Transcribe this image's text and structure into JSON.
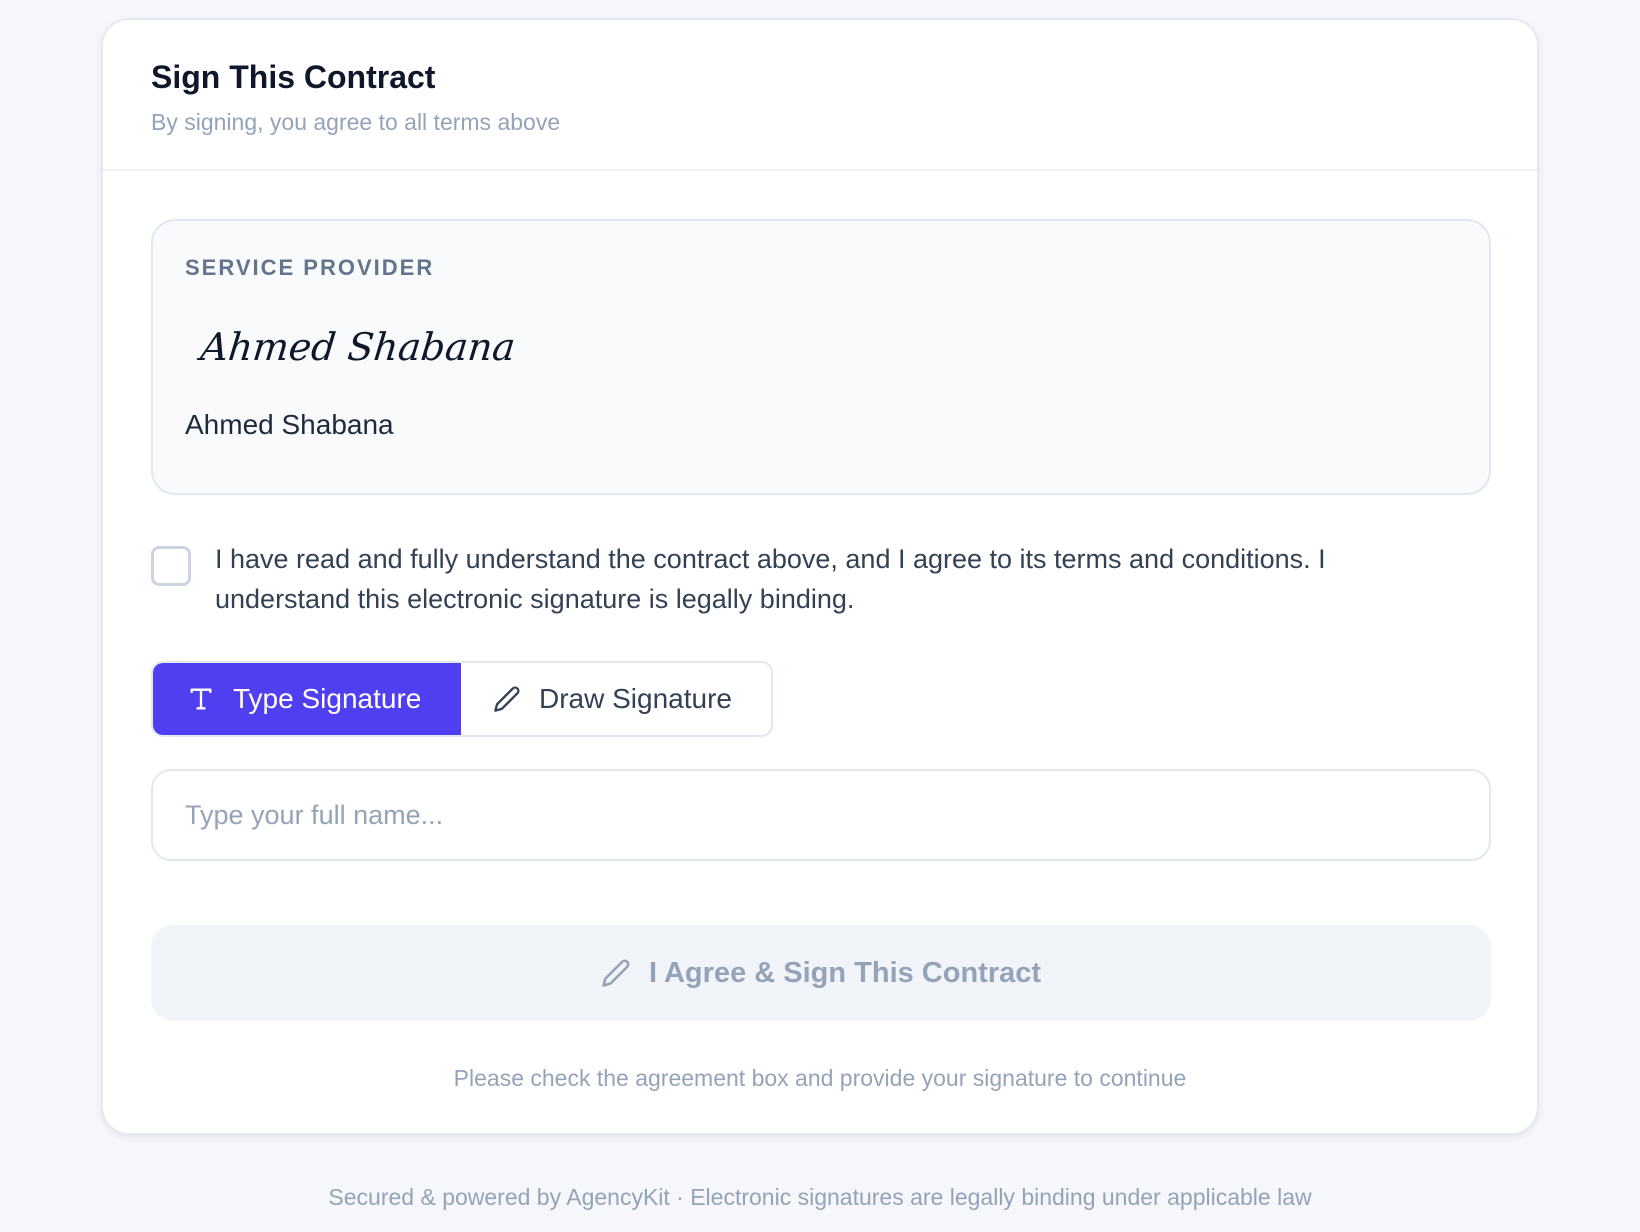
{
  "header": {
    "title": "Sign This Contract",
    "subtitle": "By signing, you agree to all terms above"
  },
  "provider": {
    "label": "SERVICE PROVIDER",
    "signature": "Ahmed Shabana",
    "name": "Ahmed Shabana"
  },
  "agreement": {
    "checked": false,
    "text": "I have read and fully understand the contract above, and I agree to its terms and conditions. I understand this electronic signature is legally binding."
  },
  "signature_tabs": [
    {
      "label": "Type Signature",
      "icon": "text-type-icon",
      "active": true
    },
    {
      "label": "Draw Signature",
      "icon": "pencil-icon",
      "active": false
    }
  ],
  "name_input": {
    "value": "",
    "placeholder": "Type your full name..."
  },
  "sign_button": {
    "label": "I Agree & Sign This Contract",
    "icon": "pencil-icon",
    "disabled": true
  },
  "helper_text": "Please check the agreement box and provide your signature to continue",
  "footer": "Secured & powered by AgencyKit · Electronic signatures are legally binding under applicable law",
  "colors": {
    "accent": "#4f3ff0",
    "muted_text": "#94a3b8",
    "border": "#e2e8f0"
  }
}
